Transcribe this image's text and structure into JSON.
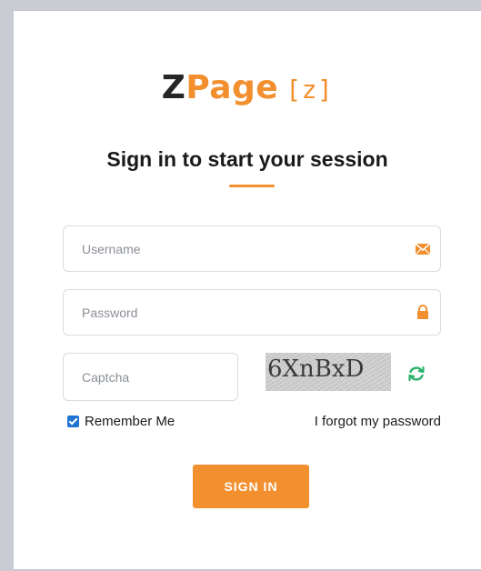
{
  "logo": {
    "z": "Z",
    "page": "Page",
    "bracket": "[z]"
  },
  "title": "Sign in to start your session",
  "username": {
    "placeholder": "Username",
    "value": "",
    "icon": "envelope-icon"
  },
  "password": {
    "placeholder": "Password",
    "value": "",
    "icon": "lock-icon"
  },
  "captcha": {
    "placeholder": "Captcha",
    "value": "",
    "image_text": "6XnBxD",
    "refresh_icon": "refresh-icon"
  },
  "remember": {
    "label": "Remember Me",
    "checked": true
  },
  "forgot_label": "I forgot my password",
  "signin_label": "SIGN IN",
  "colors": {
    "accent": "#f28f2e",
    "checkbox": "#1f73d1",
    "refresh": "#2db36b"
  }
}
